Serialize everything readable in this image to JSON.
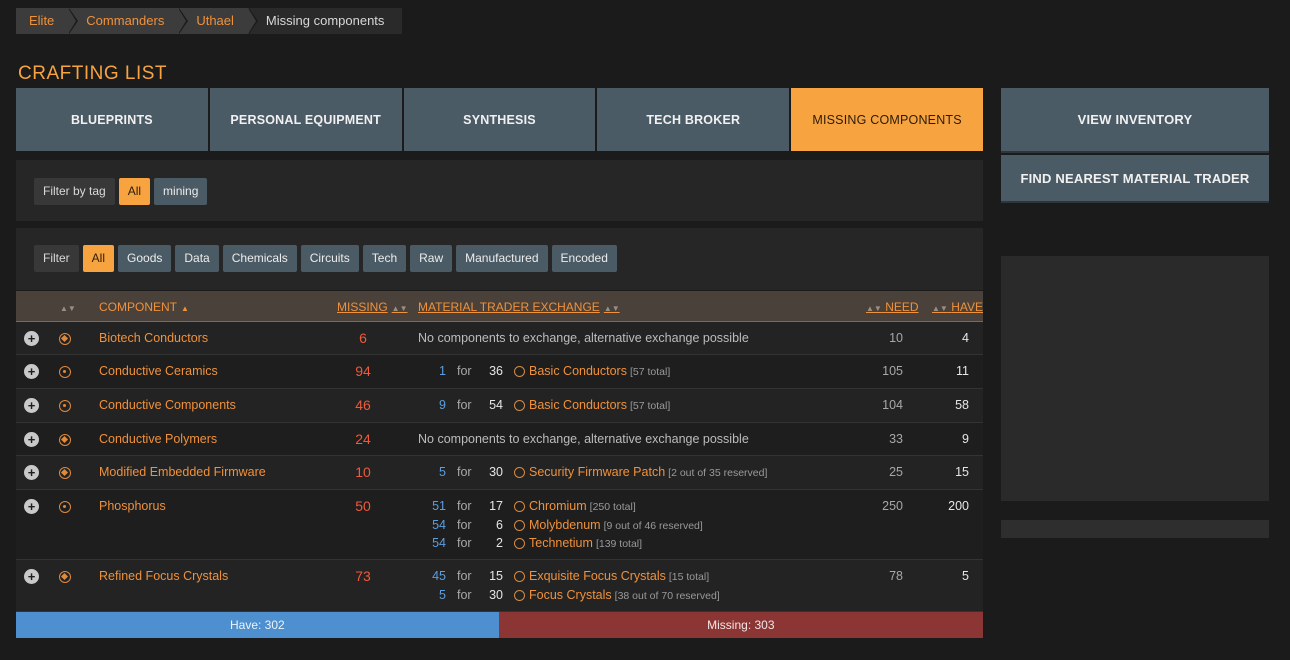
{
  "breadcrumb": [
    "Elite",
    "Commanders",
    "Uthael",
    "Missing components"
  ],
  "page_title": "CRAFTING LIST",
  "tabs": [
    "BLUEPRINTS",
    "PERSONAL EQUIPMENT",
    "SYNTHESIS",
    "TECH BROKER",
    "MISSING COMPONENTS"
  ],
  "active_tab": "MISSING COMPONENTS",
  "side_buttons": {
    "view_inventory": "VIEW INVENTORY",
    "find_trader": "FIND NEAREST MATERIAL TRADER"
  },
  "tag_filter": {
    "label": "Filter by tag",
    "options": [
      "All",
      "mining"
    ],
    "active": "All"
  },
  "type_filter": {
    "label": "Filter",
    "options": [
      "All",
      "Goods",
      "Data",
      "Chemicals",
      "Circuits",
      "Tech",
      "Raw",
      "Manufactured",
      "Encoded"
    ],
    "active": "All"
  },
  "columns": {
    "component": "COMPONENT",
    "missing": "MISSING",
    "exchange": "MATERIAL TRADER EXCHANGE",
    "need": "NEED",
    "have": "HAVE"
  },
  "rows": [
    {
      "component": "Biotech Conductors",
      "missing": "6",
      "need": "10",
      "have": "4",
      "no_exchange": "No components to exchange, alternative exchange possible",
      "exchanges": []
    },
    {
      "component": "Conductive Ceramics",
      "missing": "94",
      "need": "105",
      "have": "11",
      "exchanges": [
        {
          "a": "1",
          "for": "for",
          "b": "36",
          "name": "Basic Conductors",
          "note": "[57 total]"
        }
      ]
    },
    {
      "component": "Conductive Components",
      "missing": "46",
      "need": "104",
      "have": "58",
      "exchanges": [
        {
          "a": "9",
          "for": "for",
          "b": "54",
          "name": "Basic Conductors",
          "note": "[57 total]"
        }
      ]
    },
    {
      "component": "Conductive Polymers",
      "missing": "24",
      "need": "33",
      "have": "9",
      "no_exchange": "No components to exchange, alternative exchange possible",
      "exchanges": []
    },
    {
      "component": "Modified Embedded Firmware",
      "missing": "10",
      "need": "25",
      "have": "15",
      "exchanges": [
        {
          "a": "5",
          "for": "for",
          "b": "30",
          "name": "Security Firmware Patch",
          "note": "[2 out of 35 reserved]"
        }
      ]
    },
    {
      "component": "Phosphorus",
      "missing": "50",
      "need": "250",
      "have": "200",
      "exchanges": [
        {
          "a": "51",
          "for": "for",
          "b": "17",
          "name": "Chromium",
          "note": "[250 total]"
        },
        {
          "a": "54",
          "for": "for",
          "b": "6",
          "name": "Molybdenum",
          "note": "[9 out of 46 reserved]"
        },
        {
          "a": "54",
          "for": "for",
          "b": "2",
          "name": "Technetium",
          "note": "[139 total]"
        }
      ]
    },
    {
      "component": "Refined Focus Crystals",
      "missing": "73",
      "need": "78",
      "have": "5",
      "exchanges": [
        {
          "a": "45",
          "for": "for",
          "b": "15",
          "name": "Exquisite Focus Crystals",
          "note": "[15 total]"
        },
        {
          "a": "5",
          "for": "for",
          "b": "30",
          "name": "Focus Crystals",
          "note": "[38 out of 70 reserved]"
        }
      ]
    }
  ],
  "summary": {
    "have_label": "Have: 302",
    "missing_label": "Missing: 303",
    "have": 302,
    "missing": 303
  },
  "colors": {
    "accent": "#f7a440",
    "tab": "#4b5b65",
    "have_bar": "#4e8fcf",
    "missing_bar": "#8c3535"
  }
}
